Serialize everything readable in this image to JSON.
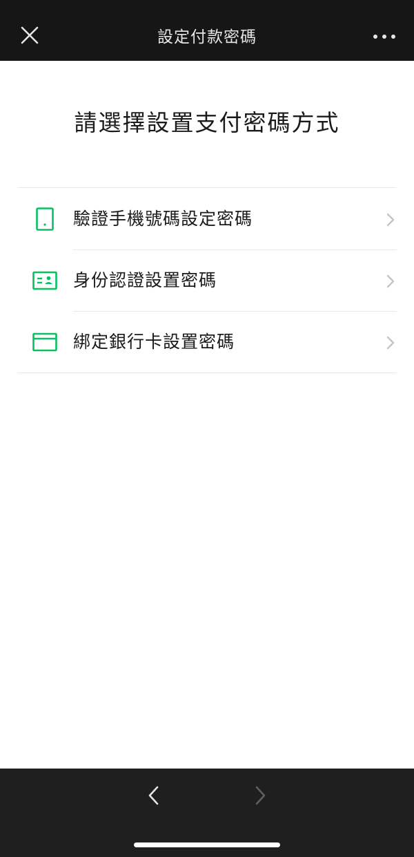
{
  "header": {
    "title": "設定付款密碼",
    "close_icon": "close-icon",
    "more_icon": "more-icon"
  },
  "main": {
    "heading": "請選擇設置支付密碼方式",
    "options": [
      {
        "label": "驗證手機號碼設定密碼",
        "icon": "phone-icon"
      },
      {
        "label": "身份認證設置密碼",
        "icon": "id-card-icon"
      },
      {
        "label": "綁定銀行卡設置密碼",
        "icon": "bank-card-icon"
      }
    ]
  },
  "footer": {
    "back_icon": "back-arrow-icon",
    "forward_icon": "forward-arrow-icon"
  },
  "colors": {
    "accent": "#07c160",
    "topbar_bg": "#161616",
    "bottombar_bg": "#1f1f1f"
  }
}
